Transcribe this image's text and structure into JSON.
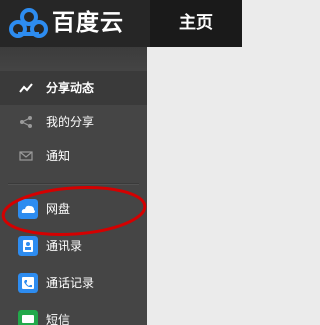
{
  "header": {
    "brand_name": "百度云",
    "home_tab": "主页"
  },
  "sidebar": {
    "items": [
      {
        "label": "分享动态",
        "icon": "activity-icon",
        "active": true
      },
      {
        "label": "我的分享",
        "icon": "share-icon"
      },
      {
        "label": "通知",
        "icon": "mail-icon"
      },
      {
        "label": "网盘",
        "icon": "cloud-drive-icon",
        "highlighted": true
      },
      {
        "label": "通讯录",
        "icon": "contacts-icon"
      },
      {
        "label": "通话记录",
        "icon": "call-log-icon"
      },
      {
        "label": "短信",
        "icon": "sms-icon"
      }
    ]
  },
  "colors": {
    "topbar": "#1f1f1f",
    "sidebar": "#454545",
    "content": "#ebebeb",
    "brand_blue": "#2d8cf0",
    "highlight_ellipse": "#d40000"
  }
}
